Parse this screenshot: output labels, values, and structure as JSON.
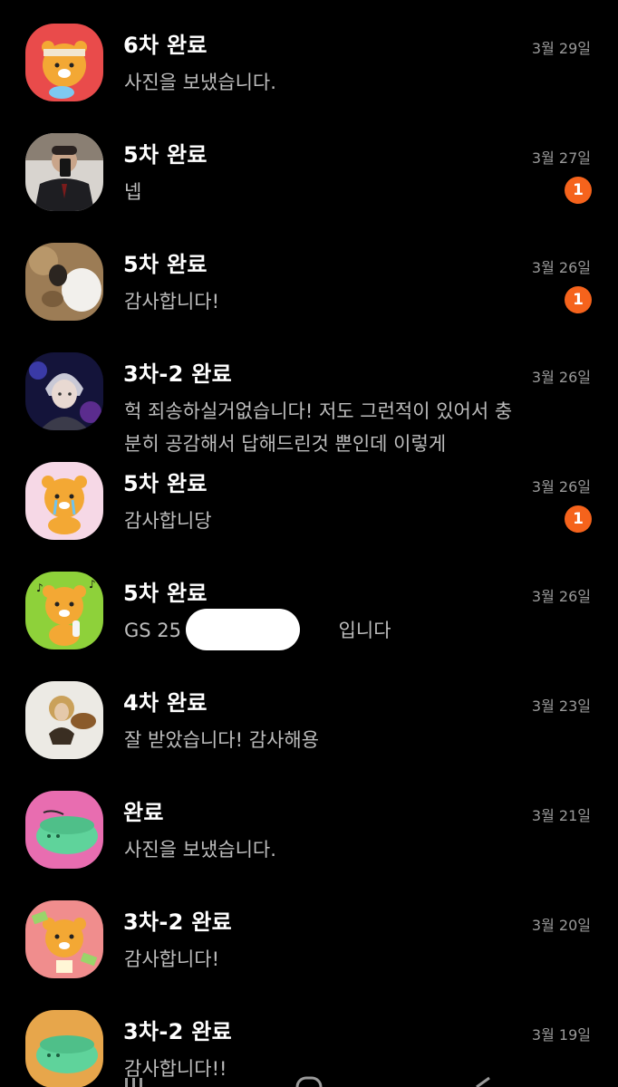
{
  "chats": [
    {
      "name": "6차 완료",
      "preview": "사진을 보냈습니다.",
      "date": "3월 29일",
      "badge": "",
      "avatar_icon": "ryan-headband-avatar-icon"
    },
    {
      "name": "5차 완료",
      "preview": "넵",
      "date": "3월 27일",
      "badge": "1",
      "avatar_icon": "selfie-photo-avatar-icon"
    },
    {
      "name": "5차 완료",
      "preview": "감사합니다!",
      "date": "3월 26일",
      "badge": "1",
      "avatar_icon": "photo-avatar-icon"
    },
    {
      "name": "3차-2 완료",
      "preview": "헉 죄송하실거없습니다! 저도 그런적이 있어서 충분히 공감해서 답해드린것 뿐인데 이렇게",
      "date": "3월 26일",
      "badge": "",
      "avatar_icon": "anime-character-avatar-icon"
    },
    {
      "name": "5차 완료",
      "preview": "감사합니당",
      "date": "3월 26일",
      "badge": "1",
      "avatar_icon": "ryan-crying-avatar-icon"
    },
    {
      "name": "5차 완료",
      "preview": "GS 25                          입니다",
      "date": "3월 26일",
      "badge": "",
      "avatar_icon": "ryan-singing-avatar-icon"
    },
    {
      "name": "4차 완료",
      "preview": "잘 받았습니다! 감사해용",
      "date": "3월 23일",
      "badge": "",
      "avatar_icon": "photo-avatar-icon"
    },
    {
      "name": "완료",
      "preview": "사진을 보냈습니다.",
      "date": "3월 21일",
      "badge": "",
      "avatar_icon": "dino-sleeping-avatar-icon"
    },
    {
      "name": "3차-2 완료",
      "preview": "감사합니다!",
      "date": "3월 20일",
      "badge": "",
      "avatar_icon": "ryan-money-avatar-icon"
    },
    {
      "name": "3차-2 완료",
      "preview": "감사합니다!!",
      "date": "3월 19일",
      "badge": "",
      "avatar_icon": "dino-sleeping-avatar-icon"
    }
  ],
  "colors": {
    "background": "#000000",
    "badge": "#f5631c",
    "name": "#ffffff",
    "preview": "#bdbdbd",
    "date": "#9a9a9a"
  }
}
